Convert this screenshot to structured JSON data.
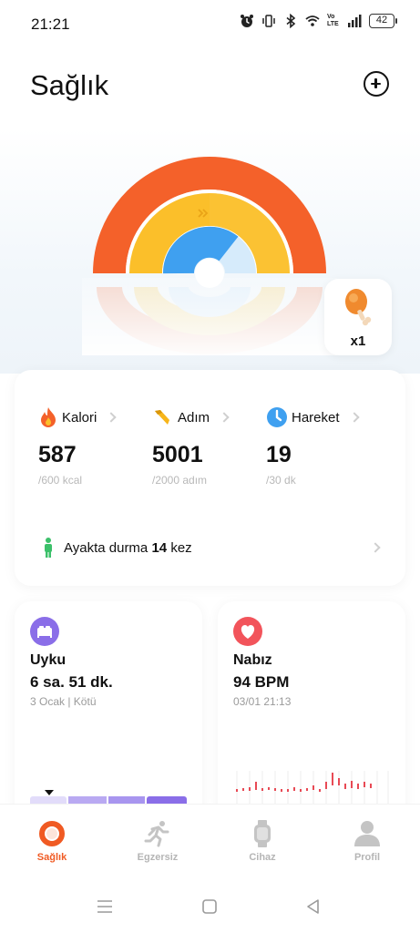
{
  "status_bar": {
    "time": "21:21",
    "network_label": "Vo LTE",
    "battery": "42"
  },
  "header": {
    "title": "Sağlık"
  },
  "food": {
    "count": "x1"
  },
  "stats": {
    "calories": {
      "label": "Kalori",
      "value": "587",
      "goal": "/600 kcal"
    },
    "steps": {
      "label": "Adım",
      "value": "5001",
      "goal": "/2000 adım"
    },
    "movement": {
      "label": "Hareket",
      "value": "19",
      "goal": "/30 dk"
    },
    "standing": {
      "prefix": "Ayakta durma",
      "count": "14",
      "suffix": "kez"
    }
  },
  "sleep_card": {
    "title": "Uyku",
    "value": "6 sa. 51 dk.",
    "sub": "3 Ocak | Kötü"
  },
  "heart_card": {
    "title": "Nabız",
    "value": "94 BPM",
    "sub": "03/01 21:13"
  },
  "bottom_nav": {
    "items": [
      {
        "label": "Sağlık",
        "icon": "health-ring-icon",
        "active": true
      },
      {
        "label": "Egzersiz",
        "icon": "running-icon",
        "active": false
      },
      {
        "label": "Cihaz",
        "icon": "watch-icon",
        "active": false
      },
      {
        "label": "Profil",
        "icon": "person-icon",
        "active": false
      }
    ]
  },
  "colors": {
    "calorie_ring": "#f4612a",
    "steps_ring": "#fbbf2a",
    "movement_ring": "#3fa0f0",
    "accent": "#f05a23",
    "sleep_icon_bg": "#8a6ee8",
    "heart_icon_bg": "#f2545b"
  }
}
